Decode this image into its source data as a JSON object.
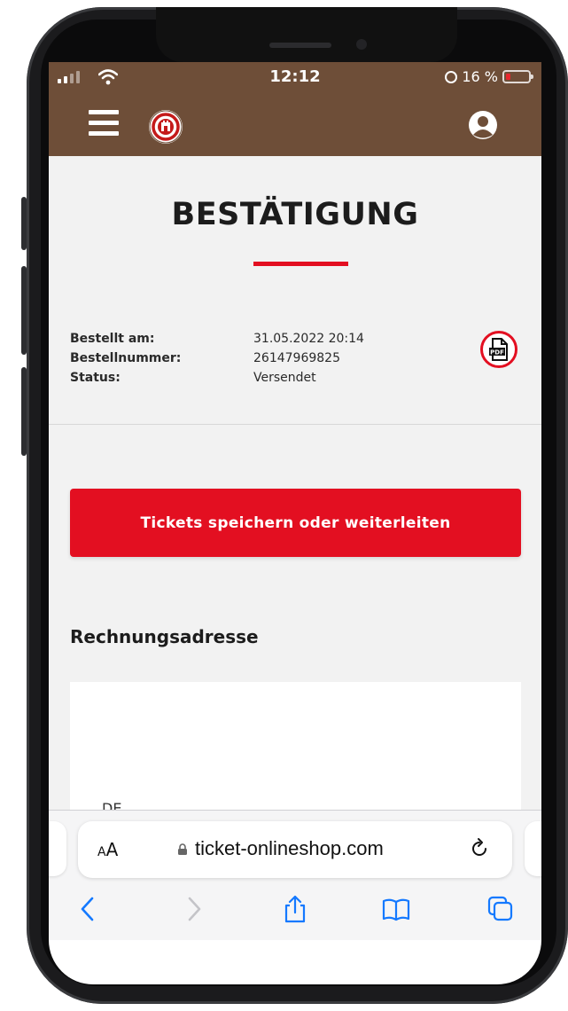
{
  "status_bar": {
    "time": "12:12",
    "battery": "16 %"
  },
  "header": {
    "menu_icon": "hamburger-menu-icon",
    "logo": "club-crest-logo",
    "user_icon": "user-account-icon"
  },
  "page": {
    "title": "BESTÄTIGUNG"
  },
  "order_info": {
    "rows": [
      {
        "label": "Bestellt am:",
        "value": "31.05.2022 20:14"
      },
      {
        "label": "Bestellnummer:",
        "value": "26147969825"
      },
      {
        "label": "Status:",
        "value": "Versendet"
      }
    ],
    "pdf_label": "PDF"
  },
  "actions": {
    "save_forward_tickets": "Tickets speichern oder weiterleiten"
  },
  "billing": {
    "section_title": "Rechnungsadresse",
    "country": "DE"
  },
  "browser": {
    "aa_label": "A",
    "aa_small": "A",
    "url": "ticket-onlineshop.com"
  },
  "colors": {
    "header_brown": "#6e4e38",
    "accent_red": "#e30f21",
    "page_bg": "#f2f2f2"
  }
}
